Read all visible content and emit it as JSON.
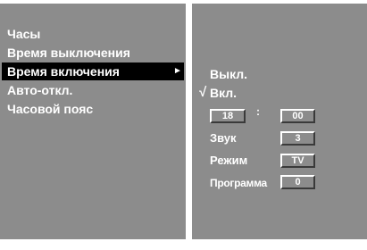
{
  "menu": {
    "items": [
      {
        "label": "Часы"
      },
      {
        "label": "Время выключения"
      },
      {
        "label": "Время включения"
      },
      {
        "label": "Авто-откл."
      },
      {
        "label": "Часовой пояс"
      }
    ],
    "selected_arrow": "►"
  },
  "submenu": {
    "off_label": "Выкл.",
    "on_label": "Вкл.",
    "checkmark": "√",
    "checked_option": "on",
    "hour": "18",
    "time_separator": ":",
    "minute": "00",
    "volume_label": "Звук",
    "volume_value": "3",
    "mode_label": "Режим",
    "mode_value": "TV",
    "program_label": "Программа",
    "program_value": "0"
  },
  "colors": {
    "panel": "#8c8c8c",
    "selection": "#000000",
    "text": "#ffffff",
    "frame": "#ffffff"
  }
}
